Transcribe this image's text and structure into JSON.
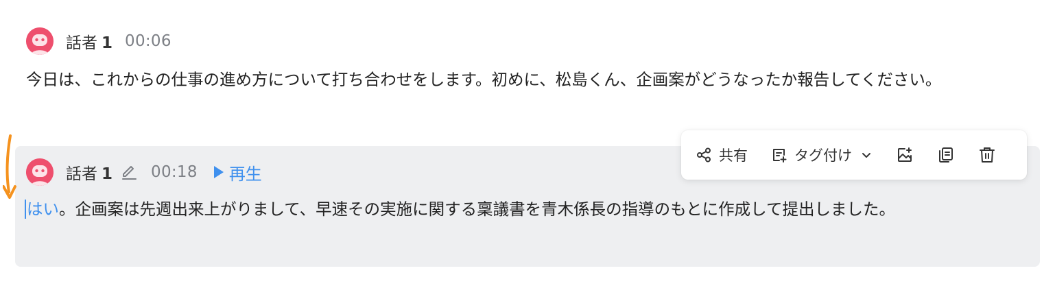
{
  "segments": [
    {
      "speaker_name": "話者",
      "speaker_num": "1",
      "timestamp": "00:06",
      "text": "今日は、これからの仕事の進め方について打ち合わせをします。初めに、松島くん、企画案がどうなったか報告してください。"
    },
    {
      "speaker_name": "話者",
      "speaker_num": "1",
      "timestamp": "00:18",
      "play_label": "再生",
      "text_highlight": "はい",
      "text_rest": "。企画案は先週出来上がりまして、早速その実施に関する稟議書を青木係長の指導のもとに作成して提出しました。"
    }
  ],
  "toolbar": {
    "share_label": "共有",
    "tag_label": "タグ付け"
  },
  "colors": {
    "accent": "#3f90ee",
    "avatar": "#ee4f6d",
    "arrow": "#f5921e",
    "selected_bg": "#eeeff1"
  },
  "icons": [
    "share-icon",
    "tag-icon",
    "chevron-down-icon",
    "image-add-icon",
    "copy-icon",
    "trash-icon",
    "pencil-icon",
    "play-icon",
    "avatar"
  ]
}
